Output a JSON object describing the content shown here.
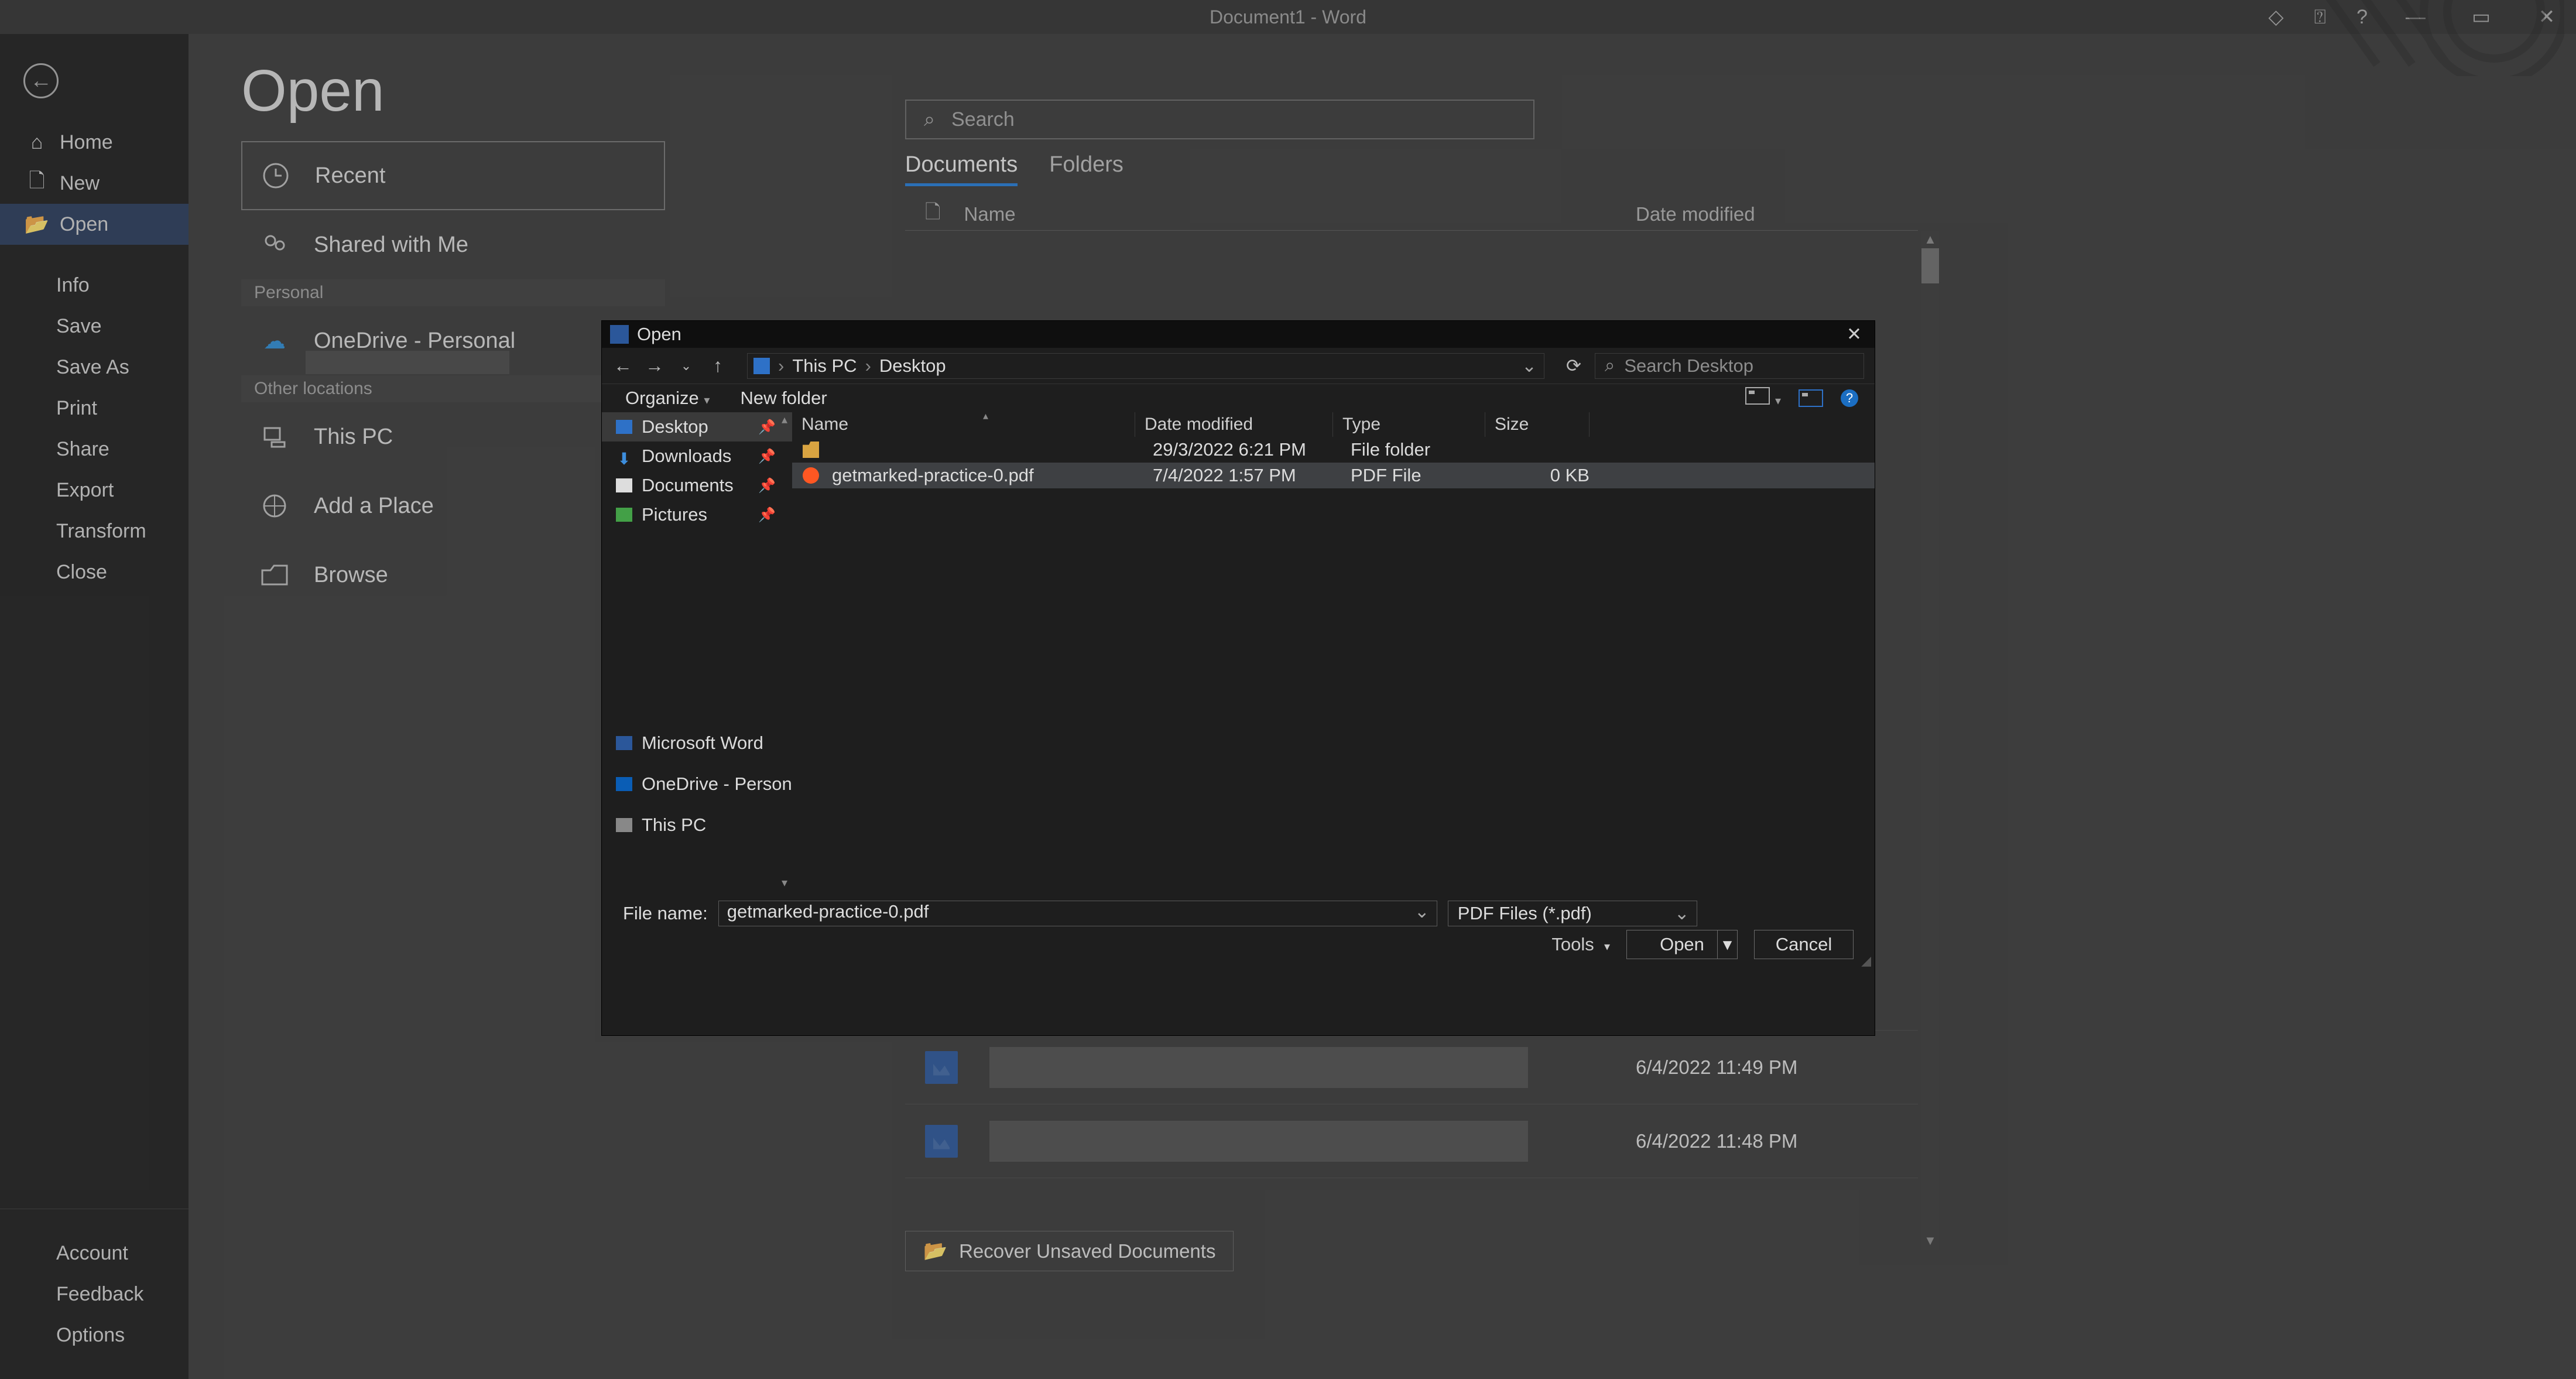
{
  "titlebar": {
    "title": "Document1 - Word"
  },
  "sidebar": {
    "items": [
      {
        "icon": "home",
        "label": "Home"
      },
      {
        "icon": "new",
        "label": "New"
      },
      {
        "icon": "open",
        "label": "Open"
      }
    ],
    "secondary": [
      "Info",
      "Save",
      "Save As",
      "Print",
      "Share",
      "Export",
      "Transform",
      "Close"
    ],
    "bottom": [
      "Account",
      "Feedback",
      "Options"
    ]
  },
  "page": {
    "heading": "Open",
    "locations": {
      "recent": "Recent",
      "shared": "Shared with Me",
      "personal_label": "Personal",
      "onedrive": "OneDrive - Personal",
      "other_label": "Other locations",
      "thispc": "This PC",
      "addplace": "Add a Place",
      "browse": "Browse"
    },
    "search_placeholder": "Search",
    "tabs": {
      "docs": "Documents",
      "folders": "Folders"
    },
    "columns": {
      "name": "Name",
      "date": "Date modified"
    },
    "recent_rows": [
      {
        "date": "6/4/2022 11:49 PM"
      },
      {
        "date": "6/4/2022 11:49 PM"
      },
      {
        "date": "6/4/2022 11:48 PM"
      }
    ],
    "recover": "Recover Unsaved Documents"
  },
  "dialog": {
    "title": "Open",
    "crumbs": [
      "This PC",
      "Desktop"
    ],
    "search_placeholder": "Search Desktop",
    "toolbar": {
      "organize": "Organize",
      "newfolder": "New folder"
    },
    "tree": [
      {
        "icon": "desk",
        "label": "Desktop",
        "pin": true,
        "sel": true
      },
      {
        "icon": "dl",
        "label": "Downloads",
        "pin": true
      },
      {
        "icon": "doc",
        "label": "Documents",
        "pin": true
      },
      {
        "icon": "pic",
        "label": "Pictures",
        "pin": true
      },
      {
        "icon": "word",
        "label": "Microsoft Word"
      },
      {
        "icon": "od",
        "label": "OneDrive - Person"
      },
      {
        "icon": "pc",
        "label": "This PC"
      }
    ],
    "columns": {
      "name": "Name",
      "date": "Date modified",
      "type": "Type",
      "size": "Size"
    },
    "files": [
      {
        "icon": "folder",
        "name": "",
        "date": "29/3/2022 6:21 PM",
        "type": "File folder",
        "size": ""
      },
      {
        "icon": "pdf",
        "name": "getmarked-practice-0.pdf",
        "date": "7/4/2022 1:57 PM",
        "type": "PDF File",
        "size": "0 KB",
        "sel": true
      }
    ],
    "footer": {
      "fn_label": "File name:",
      "fn_value": "getmarked-practice-0.pdf",
      "filter": "PDF Files (*.pdf)",
      "tools": "Tools",
      "open": "Open",
      "cancel": "Cancel"
    }
  }
}
